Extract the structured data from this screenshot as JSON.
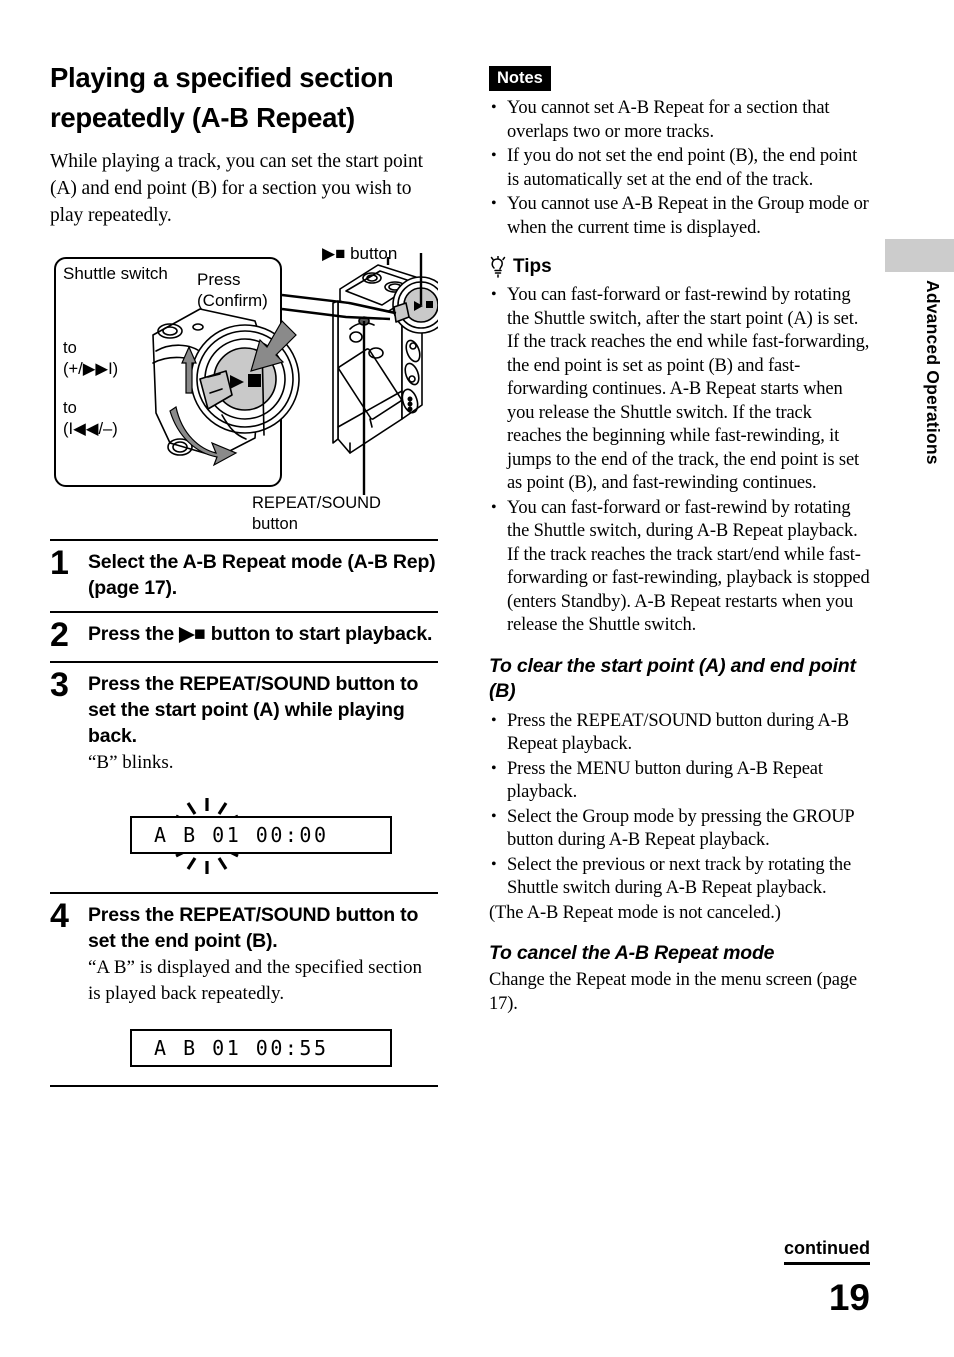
{
  "side_tab": {
    "label": "Advanced Operations",
    "block_color": "#cccccc"
  },
  "left": {
    "title": "Playing a specified section repeatedly (A-B Repeat)",
    "intro": "While playing a track, you can set the start point (A) and end point (B) for a section you wish to play repeatedly.",
    "figure": {
      "shuttle_label": "Shuttle switch",
      "press_label": "Press\n(Confirm)",
      "to_plus_label": "to\n(+/▶▶I)",
      "to_minus_label": "to\n(I◀◀/–)",
      "play_stop_button_label": "▶■ button",
      "repeat_sound_button_label": "REPEAT/SOUND\nbutton"
    },
    "steps": [
      {
        "num": "1",
        "head": "Select the A-B Repeat mode (A-B Rep) (page 17).",
        "sub": ""
      },
      {
        "num": "2",
        "head": "Press the ▶■ button to start playback.",
        "sub": ""
      },
      {
        "num": "3",
        "head": "Press the REPEAT/SOUND button to set the start point (A) while playing back.",
        "sub": "“B” blinks."
      },
      {
        "num": "4",
        "head": "Press the REPEAT/SOUND button to set the end point (B).",
        "sub": "“A B” is displayed and the specified section is played back repeatedly."
      }
    ],
    "lcd_blinking": "A B 01   00:00",
    "lcd_final": "A B 01   00:55"
  },
  "right": {
    "notes_title": "Notes",
    "notes": [
      "You cannot set A-B Repeat for a section that overlaps two or more tracks.",
      "If you do not set the end point (B), the end point is automatically set at the end of the track.",
      "You cannot use A-B Repeat in the Group mode or when the current time is displayed."
    ],
    "tips_title": "Tips",
    "tips": [
      "You can fast-forward or fast-rewind by rotating the Shuttle switch, after the start point (A) is set. If the track reaches the end while fast-forwarding, the end point is set as point (B) and fast-forwarding continues. A-B Repeat starts when you release the Shuttle switch. If the track reaches the beginning while fast-rewinding, it jumps to the end of the track, the end point is set as point (B), and fast-rewinding continues.",
      "You can fast-forward or fast-rewind by rotating the Shuttle switch, during A-B Repeat playback. If the track reaches the track start/end while fast-forwarding or fast-rewinding, playback is stopped (enters Standby). A-B Repeat restarts when you release the Shuttle switch."
    ],
    "clear_heading": "To clear the start point (A) and end point (B)",
    "clear_items": [
      "Press the REPEAT/SOUND button during A-B Repeat playback.",
      "Press the MENU button during A-B Repeat playback.",
      "Select the Group mode by pressing the GROUP button during A-B Repeat playback.",
      "Select the previous or next track by rotating the Shuttle switch during A-B Repeat playback."
    ],
    "clear_note": "(The A-B Repeat mode is not canceled.)",
    "cancel_heading": "To cancel the A-B Repeat mode",
    "cancel_text": "Change the Repeat mode in the menu screen (page 17)."
  },
  "footer": {
    "continued": "continued",
    "page_number": "19"
  }
}
